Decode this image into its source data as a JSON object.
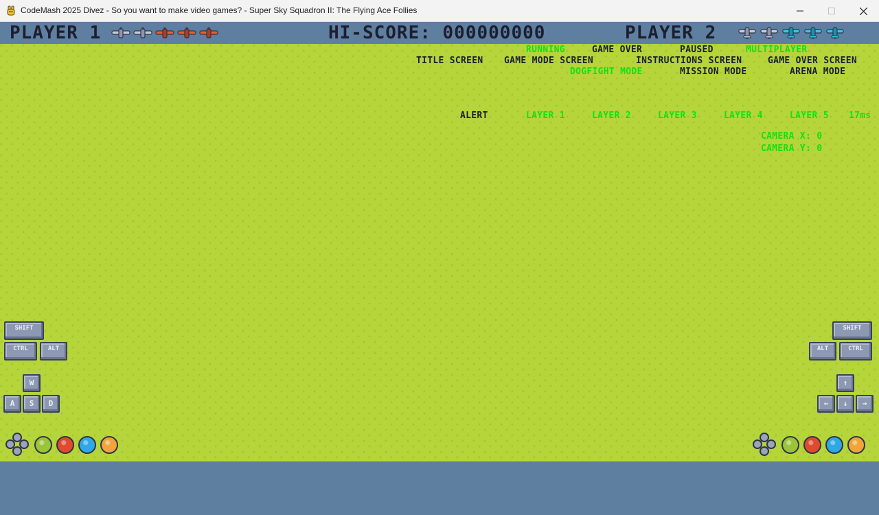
{
  "window": {
    "title": "CodeMash 2025 Divez - So you want to make video games? - Super Sky Squadron II: The Flying Ace Follies"
  },
  "hud": {
    "player1_label": "PLAYER 1",
    "player1_lives": [
      "grey",
      "grey",
      "red",
      "red",
      "red"
    ],
    "hiscore_label": "HI-SCORE: 000000000",
    "player2_label": "PLAYER 2",
    "player2_lives": [
      "grey",
      "grey",
      "cyan",
      "cyan",
      "cyan"
    ]
  },
  "debug": {
    "states": [
      {
        "label": "RUNNING",
        "active": true
      },
      {
        "label": "GAME OVER",
        "active": false
      },
      {
        "label": "PAUSED",
        "active": false
      },
      {
        "label": "MULTIPLAYER",
        "active": true
      }
    ],
    "screens": [
      {
        "label": "TITLE SCREEN",
        "active": false
      },
      {
        "label": "GAME MODE SCREEN",
        "active": false
      },
      {
        "label": "INSTRUCTIONS SCREEN",
        "active": false
      },
      {
        "label": "GAME OVER SCREEN",
        "active": false
      }
    ],
    "modes": [
      {
        "label": "DOGFIGHT MODE",
        "active": true
      },
      {
        "label": "MISSION MODE",
        "active": false
      },
      {
        "label": "ARENA MODE",
        "active": false
      }
    ],
    "layers": [
      {
        "label": "ALERT",
        "active": false
      },
      {
        "label": "LAYER 1",
        "active": true
      },
      {
        "label": "LAYER 2",
        "active": true
      },
      {
        "label": "LAYER 3",
        "active": true
      },
      {
        "label": "LAYER 4",
        "active": true
      },
      {
        "label": "LAYER 5",
        "active": true
      }
    ],
    "frame_time": "17ms",
    "camera_x": "CAMERA X: 0",
    "camera_y": "CAMERA Y: 0"
  },
  "controls_p1": {
    "shift": "SHIFT",
    "ctrl": "CTRL",
    "alt": "ALT",
    "up": "W",
    "left": "A",
    "down": "S",
    "right": "D"
  },
  "controls_p2": {
    "shift": "SHIFT",
    "ctrl": "CTRL",
    "alt": "ALT",
    "up": "↑",
    "left": "←",
    "down": "↓",
    "right": "→"
  },
  "pad_buttons": {
    "colors": [
      "#9cc43a",
      "#e04a2e",
      "#2fa8e6",
      "#f0a43a"
    ]
  },
  "colors": {
    "active": "#14e014",
    "inactive": "#1b1f2e",
    "grass": "#b5d53b",
    "hud_bg": "#5f7fa1"
  }
}
